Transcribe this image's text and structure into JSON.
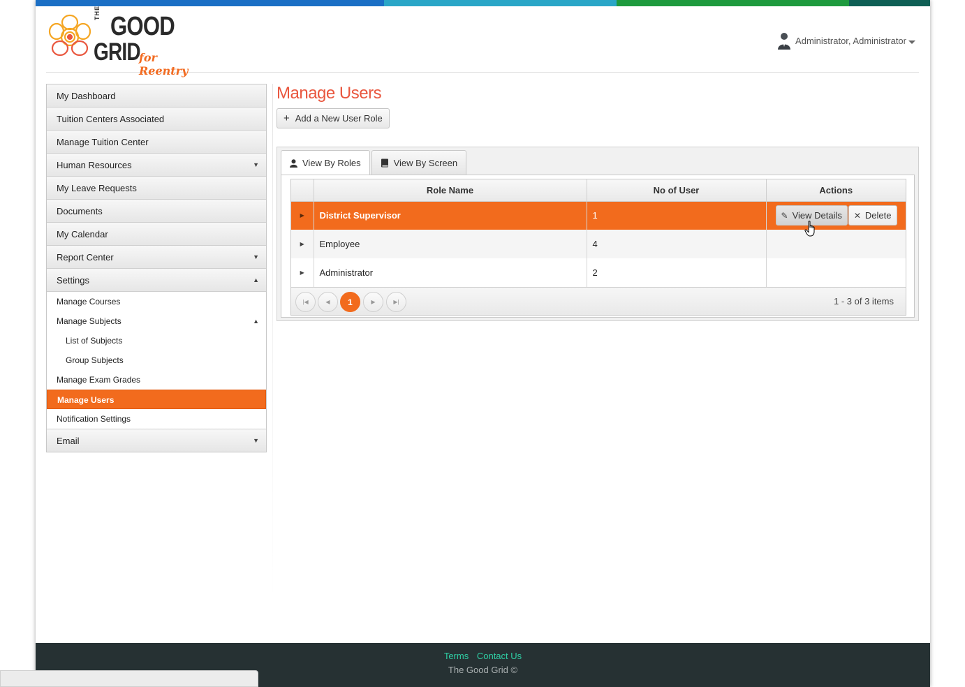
{
  "brand": {
    "the": "THE",
    "good": "GOOD",
    "grid": "GRID",
    "tagline": "for Reentry",
    "colors": {
      "orange": "#f26b1d",
      "title": "#e9573f",
      "footer": "#263133",
      "link": "#2fcfa5"
    },
    "topbar_colors": [
      "#1b6fc5",
      "#2aa6c7",
      "#1e9a3e",
      "#0f5f55"
    ]
  },
  "header": {
    "user_name": "Administrator, Administrator"
  },
  "sidebar": {
    "items": [
      {
        "label": "My Dashboard"
      },
      {
        "label": "Tuition Centers Associated"
      },
      {
        "label": "Manage Tuition Center"
      },
      {
        "label": "Human Resources"
      },
      {
        "label": "My Leave Requests"
      },
      {
        "label": "Documents"
      },
      {
        "label": "My Calendar"
      },
      {
        "label": "Report Center"
      },
      {
        "label": "Settings"
      },
      {
        "label": "Email"
      }
    ],
    "settings_sub": [
      {
        "label": "Manage Courses"
      },
      {
        "label": "Manage Subjects"
      },
      {
        "label": "List of Subjects"
      },
      {
        "label": "Group Subjects"
      },
      {
        "label": "Manage Exam Grades"
      },
      {
        "label": "Manage Users"
      },
      {
        "label": "Notification Settings"
      }
    ]
  },
  "main": {
    "title": "Manage Users",
    "add_button": "Add a New User Role",
    "tabs": [
      {
        "label": "View By Roles"
      },
      {
        "label": "View By Screen"
      }
    ],
    "grid": {
      "columns": [
        "Role Name",
        "No of User",
        "Actions"
      ],
      "rows": [
        {
          "role": "District Supervisor",
          "count": "1"
        },
        {
          "role": "Employee",
          "count": "4"
        },
        {
          "role": "Administrator",
          "count": "2"
        }
      ],
      "actions": {
        "view": "View Details",
        "delete": "Delete"
      },
      "pager": {
        "current_page": "1",
        "info": "1 - 3 of 3 items"
      }
    }
  },
  "footer": {
    "terms": "Terms",
    "contact": "Contact Us",
    "copyright": "The Good Grid ©"
  }
}
